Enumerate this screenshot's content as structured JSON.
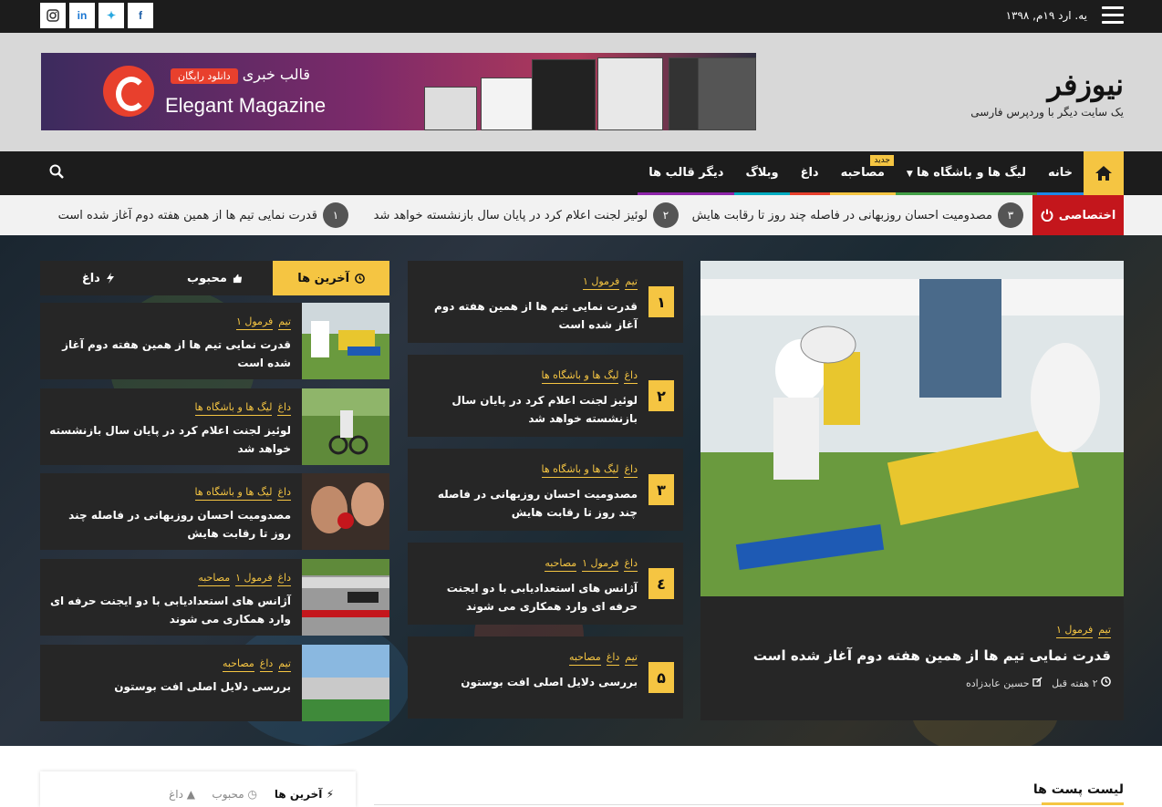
{
  "topbar": {
    "date": "یه. ارد ۱۹م, ۱۳۹۸",
    "social": [
      "instagram-icon",
      "linkedin-icon",
      "twitter-icon",
      "facebook-icon"
    ]
  },
  "site": {
    "name": "نیوزفر",
    "tagline": "یک سایت دیگر با وردپرس فارسی"
  },
  "banner": {
    "fa_title": "قالب خبری",
    "badge": "دانلود رایگان",
    "en_title": "Elegant Magazine"
  },
  "nav": {
    "items": [
      {
        "label": "خانه",
        "color": "#1e88e5"
      },
      {
        "label": "لیگ ها و باشگاه ها",
        "color": "#43a047"
      },
      {
        "label": "مصاحبه",
        "color": "#f5c542"
      },
      {
        "label": "داغ",
        "color": "#e8402d"
      },
      {
        "label": "وبلاگ",
        "color": "#00acc1"
      },
      {
        "label": "دیگر قالب ها",
        "color": "#8e24aa"
      }
    ],
    "badge": "جدید"
  },
  "ticker": {
    "label": "اختصاصی",
    "items": [
      {
        "num": "۳",
        "text": "مصدومیت احسان روزبهانی در فاصله چند روز تا رقابت هایش"
      },
      {
        "num": "۲",
        "text": "لوئیز لجنت اعلام کرد در پایان سال بازنشسته خواهد شد"
      },
      {
        "num": "۱",
        "text": "قدرت نمایی تیم ها از همین هفته دوم آغاز شده است"
      }
    ]
  },
  "featured": {
    "cats": [
      "تیم",
      "فرمول ۱"
    ],
    "title": "قدرت نمایی تیم ها از همین هفته دوم آغاز شده است",
    "time": "۲ هفته قبل",
    "author": "حسین عابدزاده"
  },
  "ranked": [
    {
      "num": "۱",
      "cats": [
        "تیم",
        "فرمول ۱"
      ],
      "title": "قدرت نمایی تیم ها از همین هفته دوم آغاز شده است"
    },
    {
      "num": "۲",
      "cats": [
        "داغ",
        "لیگ ها و باشگاه ها"
      ],
      "title": "لوئیز لجنت اعلام کرد در پایان سال بازنشسته خواهد شد"
    },
    {
      "num": "۳",
      "cats": [
        "داغ",
        "لیگ ها و باشگاه ها"
      ],
      "title": "مصدومیت احسان روزبهانی در فاصله چند روز تا رقابت هایش"
    },
    {
      "num": "٤",
      "cats": [
        "داغ",
        "فرمول ۱",
        "مصاحبه"
      ],
      "title": "آژانس های استعدادیابی با دو ایجنت حرفه ای وارد همکاری می شوند"
    },
    {
      "num": "۵",
      "cats": [
        "تیم",
        "داغ",
        "مصاحبه"
      ],
      "title": "بررسی دلایل اصلی افت بوستون"
    }
  ],
  "tabs": [
    "آخرین ها",
    "محبوب",
    "داغ"
  ],
  "side_posts": [
    {
      "cats": [
        "تیم",
        "فرمول ۱"
      ],
      "title": "قدرت نمایی تیم ها از همین هفته دوم آغاز شده است"
    },
    {
      "cats": [
        "داغ",
        "لیگ ها و باشگاه ها"
      ],
      "title": "لوئیز لجنت اعلام کرد در پایان سال بازنشسته خواهد شد"
    },
    {
      "cats": [
        "داغ",
        "لیگ ها و باشگاه ها"
      ],
      "title": "مصدومیت احسان روزبهانی در فاصله چند روز تا رقابت هایش"
    },
    {
      "cats": [
        "داغ",
        "فرمول ۱",
        "مصاحبه"
      ],
      "title": "آژانس های استعدادیابی با دو ایجنت حرفه ای وارد همکاری می شوند"
    },
    {
      "cats": [
        "تیم",
        "داغ",
        "مصاحبه"
      ],
      "title": "بررسی دلایل اصلی افت بوستون"
    }
  ],
  "bottom": {
    "tabs": [
      "آخرین ها",
      "محبوب",
      "داغ"
    ],
    "list_title": "لیست پست ها"
  }
}
